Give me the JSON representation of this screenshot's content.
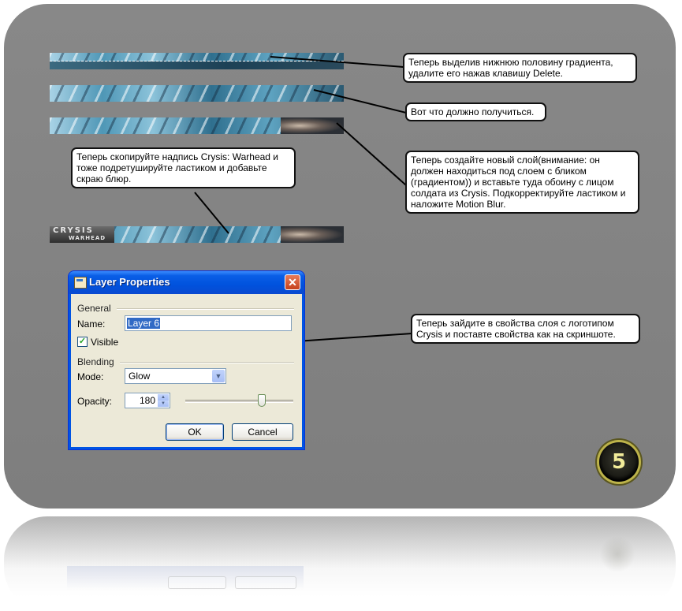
{
  "callouts": {
    "c1": "Теперь выделив нижнюю половину градиента, удалите его нажав клавишу Delete.",
    "c2": "Вот что должно получиться.",
    "c3": "Теперь создайте новый слой(внимание: он должен находиться под слоем с бликом (градиентом)) и вставьте туда обоину с лицом солдата из Crysis. Подкорректируйте ластиком и наложите Motion Blur.",
    "c4": "Теперь скопируйте надпись Crysis: Warhead и тоже подретушируйте ластиком и добавьте скраю блюр.",
    "c5": "Теперь зайдите в свойства слоя с логотипом Crysis и поставте свойства как на скриншоте."
  },
  "banner": {
    "logo_main": "CRYSIS",
    "logo_sub": "WARHEAD"
  },
  "dialog": {
    "title": "Layer Properties",
    "close_glyph": "✕",
    "general_label": "General",
    "name_label": "Name:",
    "name_value": "Layer 6",
    "visible_label": "Visible",
    "visible_checked": true,
    "check_glyph": "✓",
    "blending_label": "Blending",
    "mode_label": "Mode:",
    "mode_value": "Glow",
    "opacity_label": "Opacity:",
    "opacity_value": "180",
    "opacity_fraction": 0.706,
    "ok_label": "OK",
    "cancel_label": "Cancel"
  },
  "logo": {
    "glyph": "5"
  },
  "icons": {
    "title_icon": "layer-properties-icon",
    "combo_arrow": "chevron-down-icon",
    "spin_up": "spin-up-icon",
    "spin_down": "spin-down-icon"
  },
  "glyphs": {
    "arrow_down": "▼",
    "arrow_up": "▲"
  }
}
